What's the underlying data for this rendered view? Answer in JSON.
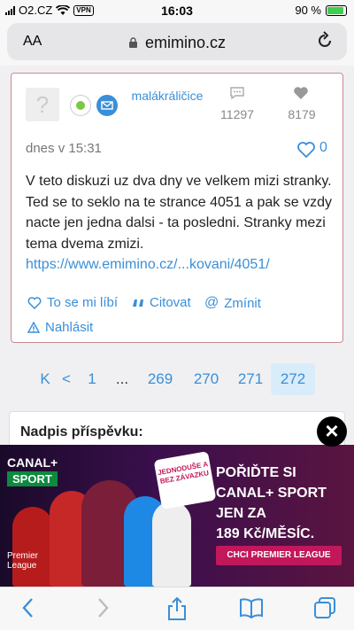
{
  "status": {
    "carrier": "O2.CZ",
    "vpn": "VPN",
    "time": "16:03",
    "battery": "90 %"
  },
  "browser": {
    "aa_label": "AA",
    "url": "emimino.cz"
  },
  "post": {
    "author": "malákráličice",
    "posts_count": "11297",
    "likes_count": "8179",
    "date": "dnes v 15:31",
    "post_likes": "0",
    "body": "V teto diskuzi uz dva dny ve velkem mizi stranky. Ted se to seklo na te strance 4051 a pak se vzdy nacte jen jedna dalsi - ta posledni. Stranky mezi tema dvema zmizi.",
    "link": "https://www.emimino.cz/...kovani/4051/",
    "actions": {
      "like": "To se mi líbí",
      "quote": "Citovat",
      "mention": "Zmínit",
      "report": "Nahlásit"
    }
  },
  "pagination": {
    "first": "K",
    "prev": "<",
    "pages": [
      "1",
      "...",
      "269",
      "270",
      "271",
      "272"
    ],
    "current": "272"
  },
  "reply": {
    "title": "Nadpis příspěvku:"
  },
  "ad": {
    "brand": "CANAL+",
    "brand_sub": "SPORT",
    "badge": "JEDNODUŠE A BEZ ZÁVAZKU",
    "headline": [
      "POŘIĎTE SI",
      "CANAL+ SPORT",
      "JEN ZA",
      "189 Kč/MĚSÍC."
    ],
    "cta": "CHCI PREMIER LEAGUE",
    "league": [
      "Premier",
      "League"
    ],
    "close": "×"
  },
  "colors": {
    "link": "#3a8fd8",
    "post_border": "#c98a93",
    "sport_green": "#0d8a3e",
    "cta": "#c2185b"
  }
}
